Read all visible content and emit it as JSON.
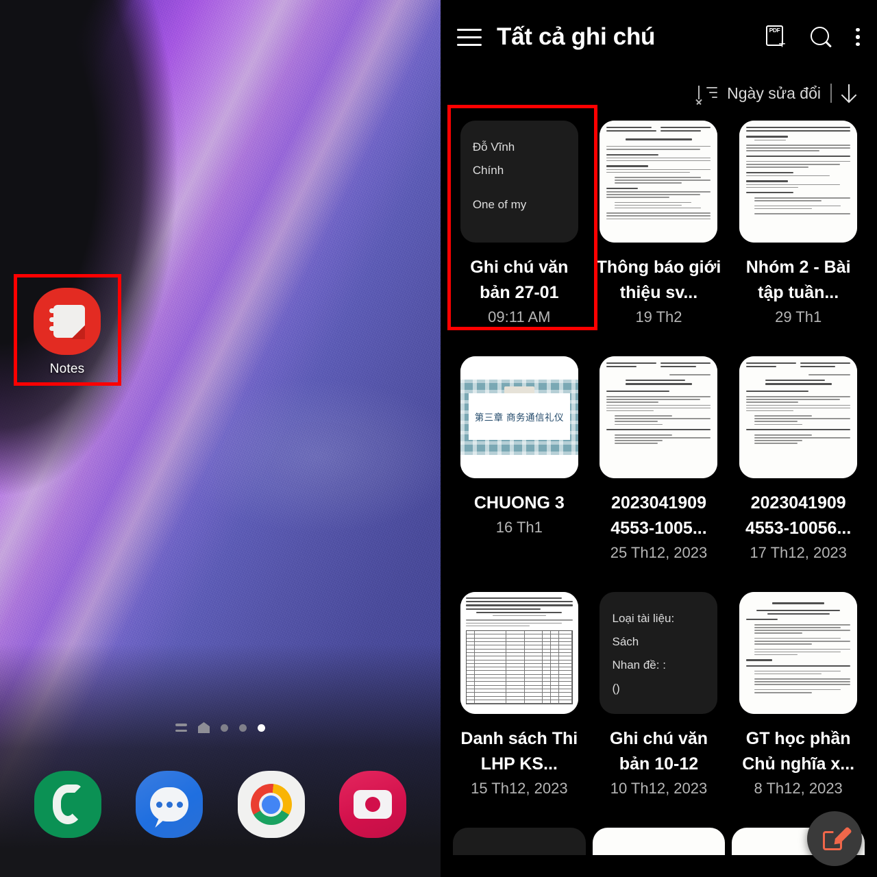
{
  "home_screen": {
    "app": {
      "label": "Notes",
      "icon": "notes-icon",
      "highlighted": true
    },
    "page_indicator": {
      "pages": 5,
      "active_index": 4
    },
    "dock": [
      {
        "label": "Phone",
        "icon": "phone-icon",
        "color": "#0b9154"
      },
      {
        "label": "Messages",
        "icon": "message-bubble-icon",
        "color": "#2a6fd4"
      },
      {
        "label": "Chrome",
        "icon": "chrome-icon",
        "color": "#f1f1f0"
      },
      {
        "label": "Camera",
        "icon": "camera-icon",
        "color": "#d2104b"
      }
    ]
  },
  "notes_app": {
    "header": {
      "menu_icon": "hamburger-menu-icon",
      "title": "Tất cả ghi chú",
      "pdf_import_icon": "pdf-add-icon",
      "pdf_icon_text": "PDF",
      "search_icon": "search-icon",
      "overflow_icon": "more-options-icon"
    },
    "sort": {
      "sort_icon": "sort-order-icon",
      "label": "Ngày sửa đổi",
      "direction_icon": "arrow-down-icon"
    },
    "fab": {
      "icon": "compose-note-icon",
      "color": "#f0674a"
    },
    "notes": [
      {
        "title": "Ghi chú văn bản 27-01",
        "date": "09:11 AM",
        "thumb_type": "dark-text",
        "thumb_lines": [
          "Đỗ Vĩnh",
          "Chính",
          "",
          "One of my"
        ],
        "highlighted": true
      },
      {
        "title": "Thông báo giới thiệu sv...",
        "date": "19 Th2",
        "thumb_type": "scan-document"
      },
      {
        "title": "Nhóm 2 - Bài tập tuần...",
        "date": "29 Th1",
        "thumb_type": "scan-document"
      },
      {
        "title": "CHUONG 3",
        "date": "16 Th1",
        "thumb_type": "slide",
        "thumb_text": "第三章  商务通信礼仪"
      },
      {
        "title": "2023041909 4553-1005...",
        "date": "25 Th12, 2023",
        "thumb_type": "scan-outline"
      },
      {
        "title": "2023041909 4553-10056...",
        "date": "17 Th12, 2023",
        "thumb_type": "scan-outline"
      },
      {
        "title": "Danh sách Thi LHP KS...",
        "date": "15 Th12, 2023",
        "thumb_type": "scan-table"
      },
      {
        "title": "Ghi chú văn bản 10-12",
        "date": "10 Th12, 2023",
        "thumb_type": "dark-text",
        "thumb_lines": [
          "Loại tài liệu:",
          "Sách",
          " Nhan đề: :",
          "()"
        ]
      },
      {
        "title": "GT học phần Chủ nghĩa x...",
        "date": "8 Th12, 2023",
        "thumb_type": "scan-document"
      }
    ]
  },
  "annotations": {
    "highlight_color": "#ff0000"
  }
}
